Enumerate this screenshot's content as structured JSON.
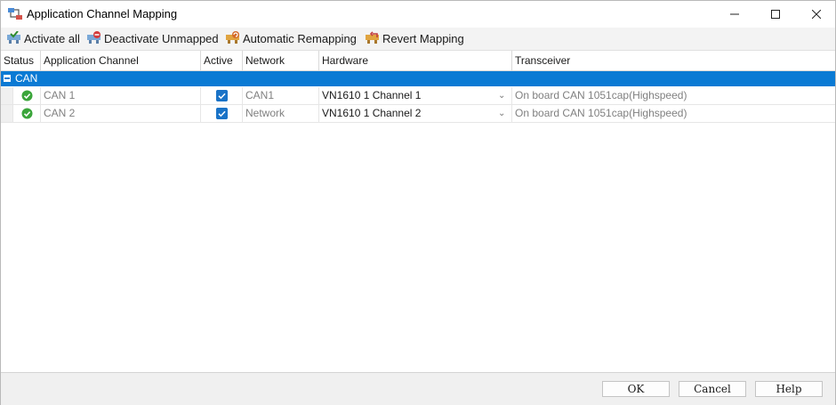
{
  "window": {
    "title": "Application Channel Mapping",
    "icon": "channel-mapping-icon"
  },
  "toolbar": {
    "items": [
      {
        "label": "Activate all",
        "icon": "activate-all-icon"
      },
      {
        "label": "Deactivate Unmapped",
        "icon": "deactivate-unmapped-icon"
      },
      {
        "label": "Automatic Remapping",
        "icon": "automatic-remapping-icon"
      },
      {
        "label": "Revert Mapping",
        "icon": "revert-mapping-icon"
      }
    ]
  },
  "table": {
    "columns": [
      "Status",
      "Application Channel",
      "Active",
      "Network",
      "Hardware",
      "Transceiver"
    ],
    "group": {
      "label": "CAN",
      "expanded": true
    },
    "rows": [
      {
        "status": "ok",
        "channel": "CAN 1",
        "active": true,
        "network": "CAN1",
        "hardware": "VN1610 1 Channel 1",
        "transceiver": "On board CAN 1051cap(Highspeed)"
      },
      {
        "status": "ok",
        "channel": "CAN 2",
        "active": true,
        "network": "Network",
        "hardware": "VN1610 1 Channel 2",
        "transceiver": "On board CAN 1051cap(Highspeed)"
      }
    ]
  },
  "footer": {
    "ok": "OK",
    "cancel": "Cancel",
    "help": "Help"
  },
  "colors": {
    "selection": "#0a7ad4",
    "status_ok": "#3aa53a",
    "checkbox": "#1a73c7"
  }
}
